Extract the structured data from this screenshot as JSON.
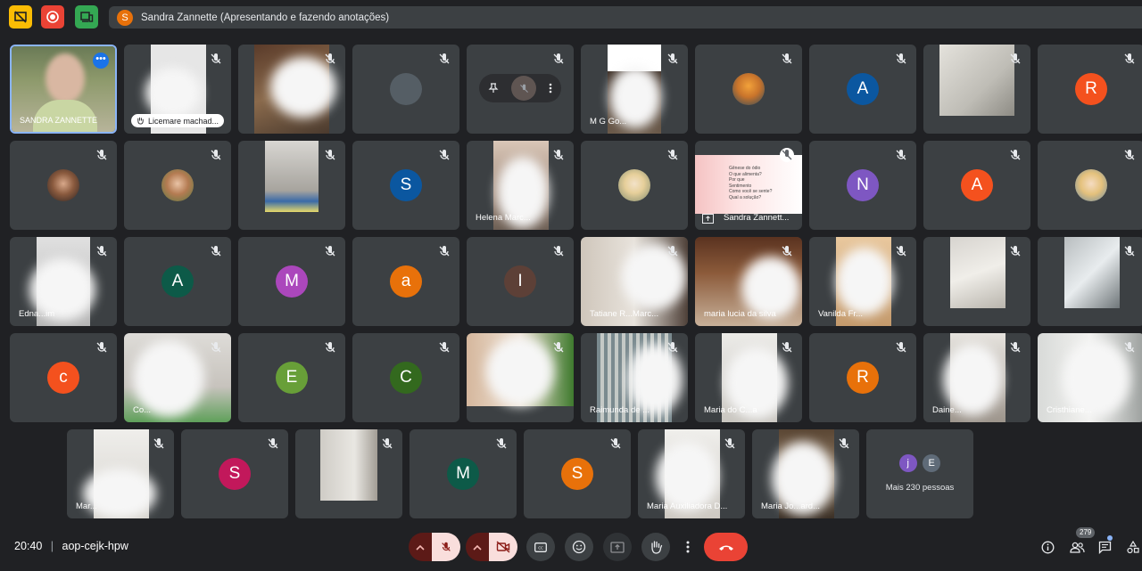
{
  "top": {
    "presenter_initial": "S",
    "presenter_status": "Sandra Zannette (Apresentando e fazendo anotações)"
  },
  "grid": {
    "self_name": "SANDRA ZANNETTE",
    "pinned_name": "Licemare machad...",
    "names": {
      "mg": "M G Go...",
      "helena": "Helena Marc...",
      "sandra_share": "Sandra Zannett...",
      "edna": "Edna...im",
      "tatiane": "Tatiane R...Marc...",
      "maria_lucia": "maria lucia da silva",
      "vanilda": "Vanilda Fr...",
      "co": "Co...",
      "raimunda": "Raimunda de ...",
      "maria_do": "Maria do C...a",
      "daine": "Daine...",
      "cristhiane": "Cristhiane...",
      "mar": "Mar...",
      "maria_aux": "Maria Auxiliadora D...",
      "maria_jo": "Maria Jo...ard..."
    },
    "initials": {
      "r1_a": "A",
      "r1_r": "R",
      "r2_s": "S",
      "r2_n": "N",
      "r2_a": "A",
      "r3_a": "A",
      "r3_m": "M",
      "r3_a2": "a",
      "r3_i": "I",
      "r4_c": "c",
      "r4_e": "E",
      "r4_c2": "C",
      "r4_r": "R",
      "r5_s": "S",
      "r5_m": "M",
      "r5_s2": "S"
    },
    "slide_lines": [
      "Gênese do ódio",
      "O que alimenta?",
      "Por que",
      "Sentimento",
      "Como você se sente?",
      "Qual a solução?"
    ],
    "more_initials": [
      "j",
      "E"
    ],
    "more_label": "Mais 230 pessoas"
  },
  "bottom": {
    "time": "20:40",
    "separator": "|",
    "meeting_code": "aop-cejk-hpw",
    "participant_count": "279"
  },
  "colors": {
    "background": "#202124",
    "tile": "#3c4043",
    "mute_red": "#ea4335",
    "end_call": "#ea4335",
    "active_border": "#8ab4f8"
  }
}
